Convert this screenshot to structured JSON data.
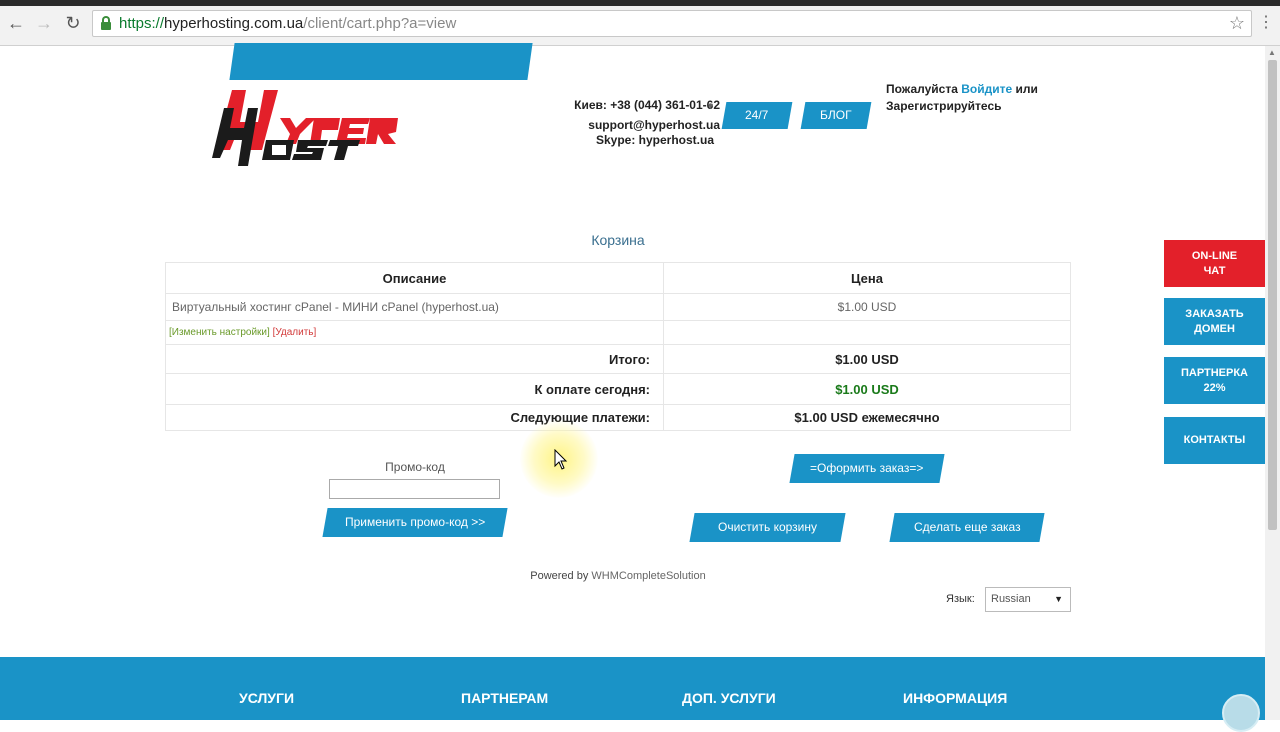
{
  "browser": {
    "url_scheme": "https://",
    "url_host": "hyperhosting.com.ua",
    "url_path": "/client/cart.php?a=view"
  },
  "header": {
    "contact_line1": "Киев: +38 (044) 361-01-62",
    "contact_line2": "support@hyperhost.ua",
    "contact_line3": "Skype: hyperhost.ua",
    "btn_247": "24/7",
    "btn_blog": "БЛОГ",
    "login_prefix": "Пожалуйста",
    "login_link": "Войдите",
    "login_or": "или",
    "register_text": "Зарегистрируйтесь"
  },
  "cart": {
    "title": "Корзина",
    "col_description": "Описание",
    "col_price": "Цена",
    "item_name": "Виртуальный хостинг cPanel - МИНИ cPanel (hyperhost.ua)",
    "item_price": "$1.00 USD",
    "link_change": "[Изменить настройки]",
    "link_delete": "[Удалить]",
    "total_label": "Итого:",
    "total_value": "$1.00 USD",
    "today_label": "К оплате сегодня:",
    "today_value": "$1.00 USD",
    "next_label": "Следующие платежи:",
    "next_value": "$1.00 USD ежемесячно"
  },
  "promo": {
    "label": "Промо-код",
    "input_value": "",
    "apply_button": "Применить промо-код >>"
  },
  "actions": {
    "checkout_button": "=Оформить заказ=>",
    "clear_button": "Очистить корзину",
    "continue_button": "Сделать еще заказ"
  },
  "powered": {
    "prefix": "Powered by",
    "name": "WHMCompleteSolution"
  },
  "language": {
    "label": "Язык:",
    "selected": "Russian"
  },
  "side_tabs": {
    "chat_line1": "ON-LINE",
    "chat_line2": "ЧАТ",
    "domain_line1": "ЗАКАЗАТЬ",
    "domain_line2": "ДОМЕН",
    "partner_line1": "ПАРТНЕРКА",
    "partner_line2": "22%",
    "contacts": "КОНТАКТЫ"
  },
  "footer": {
    "services": "УСЛУГИ",
    "partners": "ПАРТНЕРАМ",
    "extra": "ДОП. УСЛУГИ",
    "info": "ИНФОРМАЦИЯ"
  },
  "colors": {
    "accent": "#1a93c7",
    "chat_red": "#e3202a",
    "price_green": "#1a7a1a"
  }
}
